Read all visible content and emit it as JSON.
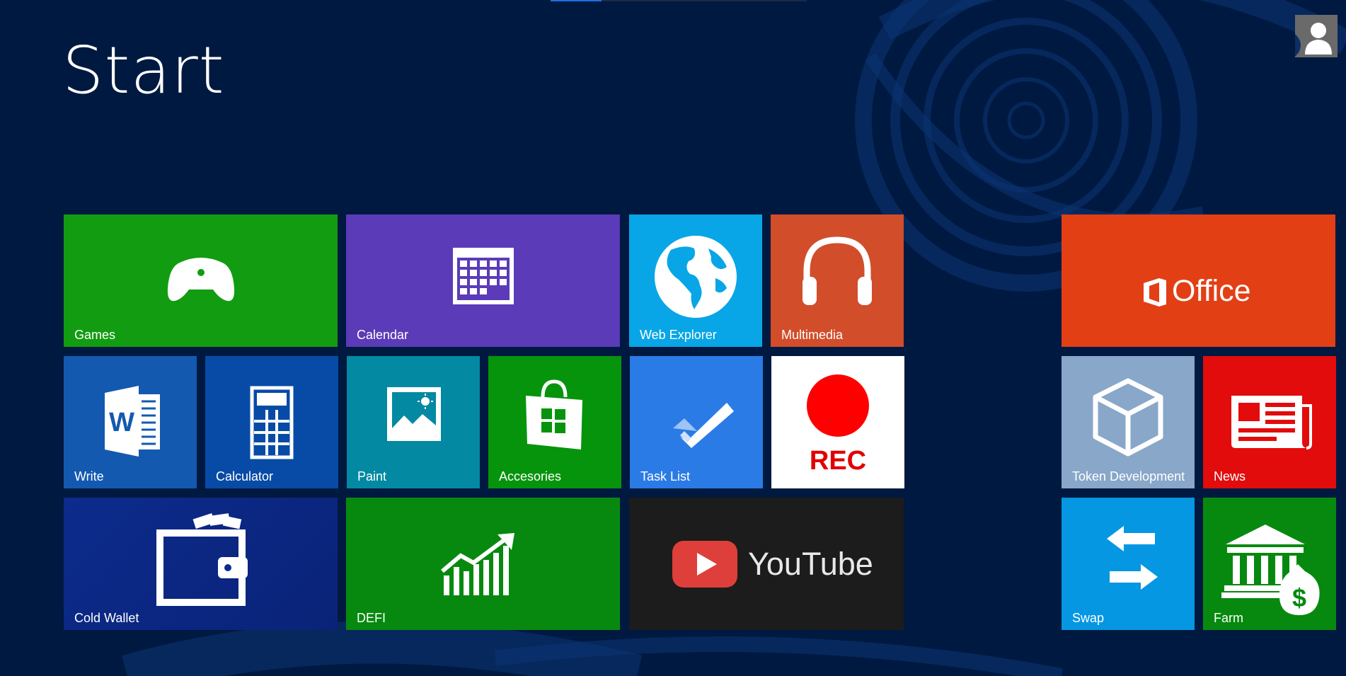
{
  "screen": {
    "title": "Start",
    "background_color": "#001940",
    "user_icon": "user-silhouette-icon"
  },
  "tiles": {
    "games": {
      "label": "Games",
      "color": "#129c11",
      "icon": "gamepad-icon"
    },
    "calendar": {
      "label": "Calendar",
      "color": "#5b3bb8",
      "icon": "calendar-icon"
    },
    "web_explorer": {
      "label": "Web Explorer",
      "color": "#08a6e6",
      "icon": "globe-icon"
    },
    "multimedia": {
      "label": "Multimedia",
      "color": "#d24d2a",
      "icon": "headphones-icon"
    },
    "office": {
      "label": "Office",
      "color": "#e23f15",
      "icon": "office-logo-icon"
    },
    "write": {
      "label": "Write",
      "color": "#1359b0",
      "icon": "word-icon"
    },
    "calculator": {
      "label": "Calculator",
      "color": "#074ba6",
      "icon": "calculator-icon"
    },
    "paint": {
      "label": "Paint",
      "color": "#0389a1",
      "icon": "picture-icon"
    },
    "accesories": {
      "label": "Accesories",
      "color": "#05940c",
      "icon": "store-bag-icon"
    },
    "task_list": {
      "label": "Task List",
      "color": "#2a7be6",
      "icon": "checkmark-icon"
    },
    "rec": {
      "label": "REC",
      "color": "#ffffff",
      "icon": "record-icon"
    },
    "token_development": {
      "label": "Token Development",
      "color": "#88a7c9",
      "icon": "cube-icon"
    },
    "news": {
      "label": "News",
      "color": "#e20c0c",
      "icon": "newspaper-icon"
    },
    "cold_wallet": {
      "label": "Cold Wallet",
      "color": "#0b2a85",
      "icon": "wallet-icon"
    },
    "defi": {
      "label": "DEFI",
      "color": "#07890f",
      "icon": "growth-chart-icon"
    },
    "youtube": {
      "label": "YouTube",
      "color": "#1c1c1c",
      "icon": "youtube-play-icon"
    },
    "swap": {
      "label": "Swap",
      "color": "#0597e2",
      "icon": "swap-arrows-icon"
    },
    "farm": {
      "label": "Farm",
      "color": "#07890f",
      "icon": "bank-money-bag-icon"
    }
  }
}
